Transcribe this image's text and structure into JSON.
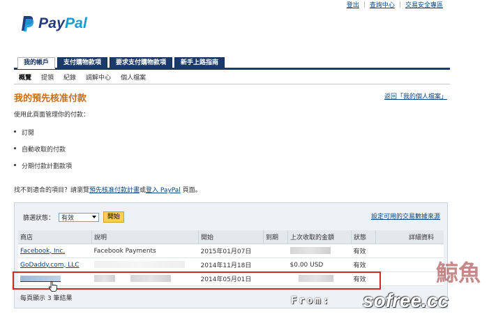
{
  "top_links": [
    "登出",
    "查詢中心",
    "交易安全專區"
  ],
  "logo": {
    "pay": "Pay",
    "pal": "Pal"
  },
  "tabs": [
    {
      "label": "我的帳戶",
      "active": true
    },
    {
      "label": "支付購物款項",
      "active": false
    },
    {
      "label": "要求支付購物款項",
      "active": false
    },
    {
      "label": "新手上路指南",
      "active": false
    }
  ],
  "subnav": [
    {
      "label": "概覽",
      "current": true
    },
    {
      "label": "提領",
      "current": false
    },
    {
      "label": "紀錄",
      "current": false
    },
    {
      "label": "調解中心",
      "current": false
    },
    {
      "label": "個人檔案",
      "current": false
    }
  ],
  "page_title": "我的預先核准付款",
  "return_link": "返回「我的個人檔案」",
  "intro": "使用此頁面管理你的付款：",
  "bullets": [
    "訂閱",
    "自動收取的付款",
    "分期付款計劃款項"
  ],
  "not_found": {
    "prefix": "找不到適合的項目？請瀏覽",
    "link1": "預先核准付款計畫",
    "middle": "或",
    "link2": "登入 PayPal",
    "suffix": " 頁面。"
  },
  "filter": {
    "label": "篩選狀態：",
    "selected": "有效",
    "go_button": "開始"
  },
  "settings_link": "設定可用的交易數據來源",
  "table": {
    "headers": [
      "商店",
      "說明",
      "開始",
      "到期",
      "上次收取的金額",
      "狀態",
      "詳細資料"
    ],
    "rows": [
      {
        "store": "Facebook, Inc.",
        "description": "Facebook Payments",
        "start": "2015年01月07日",
        "expiry": "",
        "last_amount": "",
        "status": "有效"
      },
      {
        "store": "GoDaddy.com, LLC",
        "description": "",
        "start": "2014年11月18日",
        "expiry": "",
        "last_amount": "$0.00 USD",
        "status": "有效"
      },
      {
        "store": "",
        "description": "",
        "start": "2014年05月01日",
        "expiry": "",
        "last_amount": "",
        "status": "有效"
      }
    ]
  },
  "result_count": "每頁顯示 3 筆結果",
  "watermark": {
    "from": "From:",
    "site": "sofree.cc",
    "mark2": "鯨魚"
  },
  "colors": {
    "accent_title": "#c56e1b",
    "nav_dark": "#1a3a6b",
    "link": "#084482",
    "highlight": "#d7262a",
    "button": "#ffcd5a"
  }
}
